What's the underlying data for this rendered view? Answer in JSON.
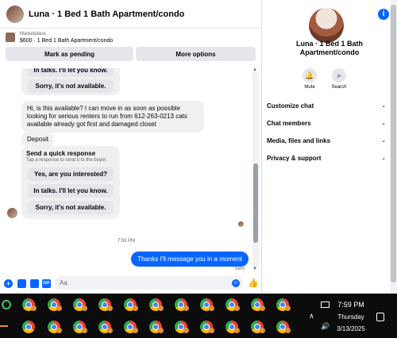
{
  "header": {
    "title": "Luna · 1 Bed 1 Bath Apartment/condo"
  },
  "listing": {
    "source": "Marketplace",
    "line": "$600 · 1 Bed 1 Bath Apartment/condo",
    "mark_pending": "Mark as pending",
    "more_options": "More options"
  },
  "chat": {
    "top_card_buttons": [
      "In talks. I'll let you know.",
      "Sorry, it's not available."
    ],
    "message_in": "Hi, is this available? I can move in as soon as possible looking for serious renters to run from 612-263-0213 cats available already got first and damaged closet",
    "deposit": "Deposit",
    "quick_response": {
      "title": "Send a quick response",
      "subtitle": "Tap a response to send it to the buyer.",
      "buttons": [
        "Yes, are you interested?",
        "In talks. I'll let you know.",
        "Sorry, it's not available."
      ]
    },
    "timestamp": "7:59 PM",
    "message_out": "Thanks I'll message you in a moment",
    "status": "Sent"
  },
  "composer": {
    "placeholder": "Aa"
  },
  "right_panel": {
    "title_line1": "Luna · 1 Bed 1 Bath",
    "title_line2": "Apartment/condo",
    "actions": [
      {
        "label": "Mute",
        "icon": "bell-icon"
      },
      {
        "label": "Search",
        "icon": "search-icon"
      }
    ],
    "sections": [
      "Customize chat",
      "Chat members",
      "Media, files and links",
      "Privacy & support"
    ]
  },
  "taskbar": {
    "time": "7:59 PM",
    "day": "Thursday",
    "date": "3/13/2025",
    "app_count_per_row": 11
  },
  "colors": {
    "accent": "#0866ff",
    "taskbar": "#0c0c0c"
  }
}
